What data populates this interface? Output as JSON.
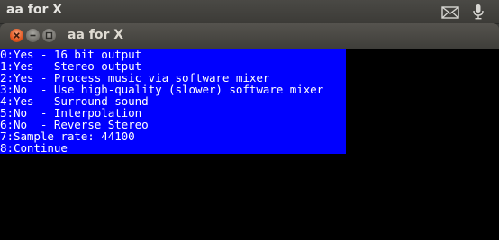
{
  "top_panel": {
    "title": "aa for X",
    "tray_icons": [
      "mail-icon",
      "microphone-icon"
    ]
  },
  "window": {
    "title": "aa for X",
    "controls": [
      "close",
      "minimize",
      "maximize"
    ]
  },
  "terminal": {
    "menu_lines": [
      "0:Yes - 16 bit output",
      "1:Yes - Stereo output",
      "2:Yes - Process music via software mixer",
      "3:No  - Use high-quality (slower) software mixer",
      "4:Yes - Surround sound",
      "5:No  - Interpolation",
      "6:No  - Reverse Stereo",
      "7:Sample rate: 44100",
      "8:Continue"
    ],
    "colors": {
      "highlight_background": "#0000ff",
      "text": "#ffffff",
      "background": "#000000"
    }
  }
}
